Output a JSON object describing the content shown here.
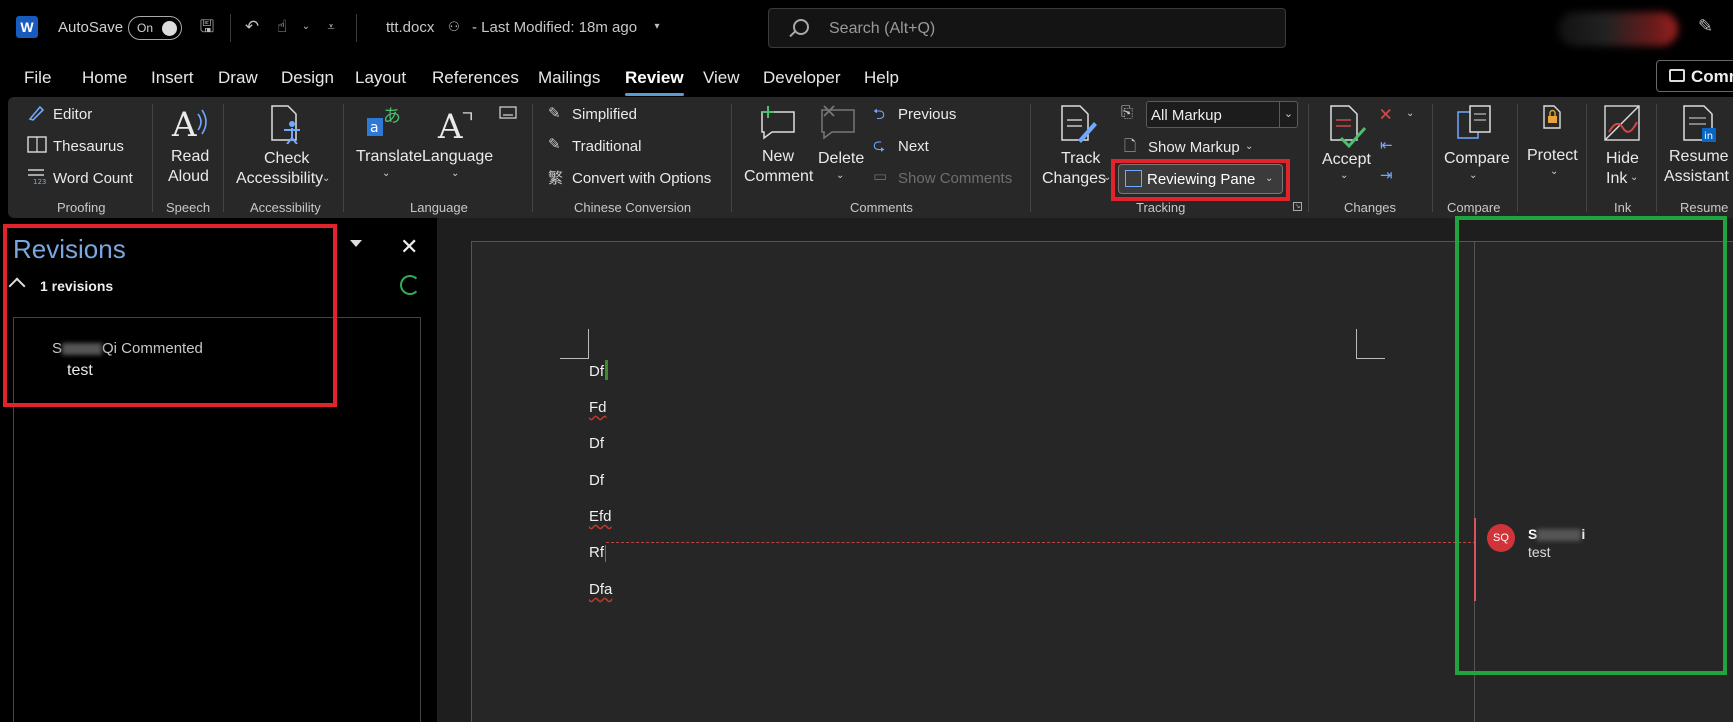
{
  "titlebar": {
    "autosave_label": "AutoSave",
    "toggle_state": "On",
    "filename": "ttt.docx",
    "last_modified": "-  Last Modified: 18m ago",
    "search_placeholder": "Search (Alt+Q)"
  },
  "menu": {
    "tabs": [
      "File",
      "Home",
      "Insert",
      "Draw",
      "Design",
      "Layout",
      "References",
      "Mailings",
      "Review",
      "View",
      "Developer",
      "Help"
    ],
    "active_tab": "Review",
    "comments_button": "Comm"
  },
  "ribbon": {
    "proofing": {
      "editor": "Editor",
      "thesaurus": "Thesaurus",
      "word_count": "Word Count",
      "group": "Proofing"
    },
    "speech": {
      "read_aloud_1": "Read",
      "read_aloud_2": "Aloud",
      "group": "Speech"
    },
    "accessibility": {
      "check_1": "Check",
      "check_2": "Accessibility",
      "group": "Accessibility"
    },
    "language": {
      "translate": "Translate",
      "language": "Language",
      "group": "Language"
    },
    "chinese": {
      "simplified": "Simplified",
      "traditional": "Traditional",
      "convert": "Convert with Options",
      "group": "Chinese Conversion"
    },
    "comments": {
      "new_1": "New",
      "new_2": "Comment",
      "delete": "Delete",
      "previous": "Previous",
      "next": "Next",
      "show_comments": "Show Comments",
      "group": "Comments"
    },
    "tracking": {
      "track_1": "Track",
      "track_2": "Changes",
      "all_markup": "All Markup",
      "show_markup": "Show Markup",
      "reviewing_pane": "Reviewing Pane",
      "group": "Tracking"
    },
    "changes": {
      "accept": "Accept",
      "group": "Changes"
    },
    "compare": {
      "compare": "Compare",
      "group": "Compare"
    },
    "protect": {
      "protect": "Protect"
    },
    "ink": {
      "hide_1": "Hide",
      "hide_2": "Ink",
      "group": "Ink"
    },
    "resume": {
      "resume_1": "Resume",
      "resume_2": "Assistant",
      "group": "Resume"
    }
  },
  "revisions": {
    "title": "Revisions",
    "count": "1 revisions",
    "author_suffix": "Qi Commented",
    "author_prefix": "S",
    "text": "test"
  },
  "document": {
    "lines": [
      "Df",
      "Fd",
      "Df",
      "Df",
      "Efd",
      "Rf",
      "Dfa"
    ]
  },
  "comment": {
    "initials": "SQ",
    "author_prefix": "S",
    "author_suffix": "i",
    "text": "test"
  },
  "colors": {
    "highlight_red": "#e0242a",
    "highlight_green": "#21a33f",
    "accent_blue": "#5b9bd5"
  }
}
